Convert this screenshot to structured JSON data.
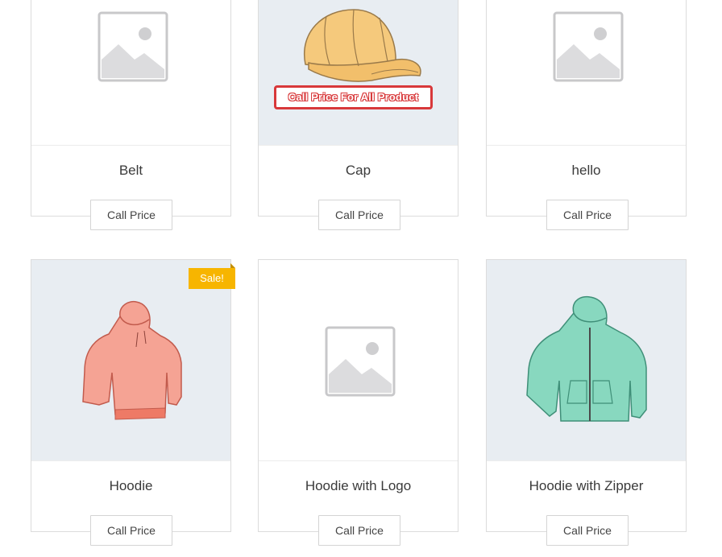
{
  "products": [
    {
      "title": "Belt",
      "button": "Call Price",
      "image": "placeholder-icon"
    },
    {
      "title": "Cap",
      "button": "Call Price",
      "image": "cap-icon",
      "notice": "Call Price For All Product"
    },
    {
      "title": "hello",
      "button": "Call Price",
      "image": "placeholder-icon"
    },
    {
      "title": "Hoodie",
      "button": "Call Price",
      "image": "hoodie-icon",
      "badge": "Sale!"
    },
    {
      "title": "Hoodie with Logo",
      "button": "Call Price",
      "image": "placeholder-icon"
    },
    {
      "title": "Hoodie with Zipper",
      "button": "Call Price",
      "image": "zip-hoodie-icon"
    }
  ],
  "colors": {
    "sale_badge": "#f7b500",
    "notice_border": "#d8383a",
    "thumb_tint": "#e8edf2"
  }
}
